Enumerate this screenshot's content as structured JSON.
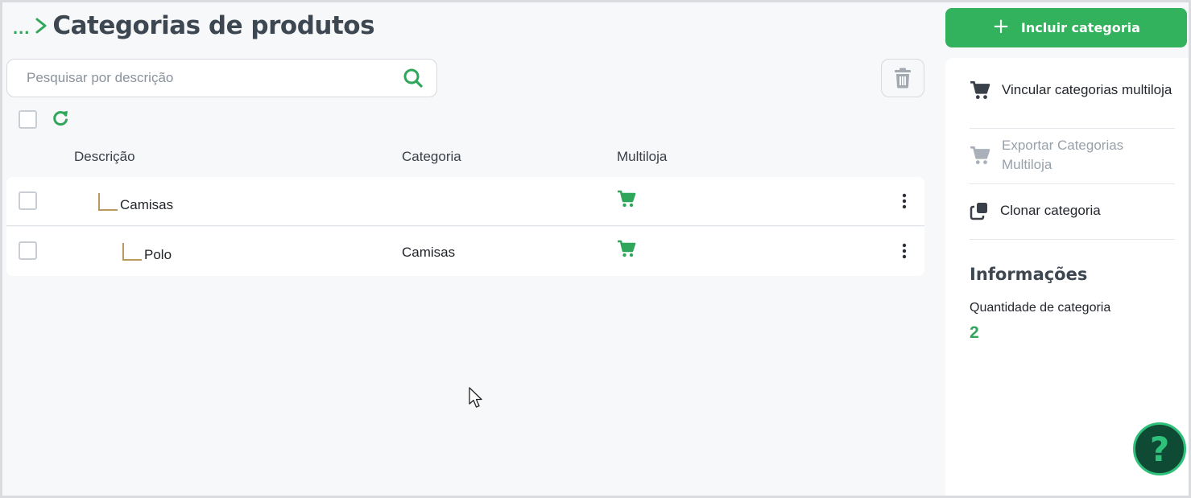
{
  "header": {
    "breadcrumb_ellipsis": "...",
    "title": "Categorias de produtos"
  },
  "search": {
    "placeholder": "Pesquisar por descrição",
    "value": ""
  },
  "table": {
    "columns": [
      "Descrição",
      "Categoria",
      "Multiloja"
    ],
    "rows": [
      {
        "descricao": "Camisas",
        "categoria": "",
        "multiloja": "cart-icon",
        "level": 1
      },
      {
        "descricao": "Polo",
        "categoria": "Camisas",
        "multiloja": "cart-icon",
        "level": 2
      }
    ]
  },
  "actions": {
    "add_label": "Incluir categoria"
  },
  "panel": {
    "items": [
      {
        "label": "Vincular categorias multiloja",
        "icon": "cart-icon",
        "enabled": true
      },
      {
        "label": "Exportar Categorias Multiloja",
        "icon": "cart-icon",
        "enabled": false
      },
      {
        "label": "Clonar categoria",
        "icon": "clone-icon",
        "enabled": true
      }
    ],
    "info_title": "Informações",
    "info_label": "Quantidade de categoria",
    "info_value": "2"
  },
  "help": {
    "label": "?"
  },
  "colors": {
    "accent": "#33b25e",
    "title": "#3d4752",
    "help_bg": "#0f4a35"
  }
}
